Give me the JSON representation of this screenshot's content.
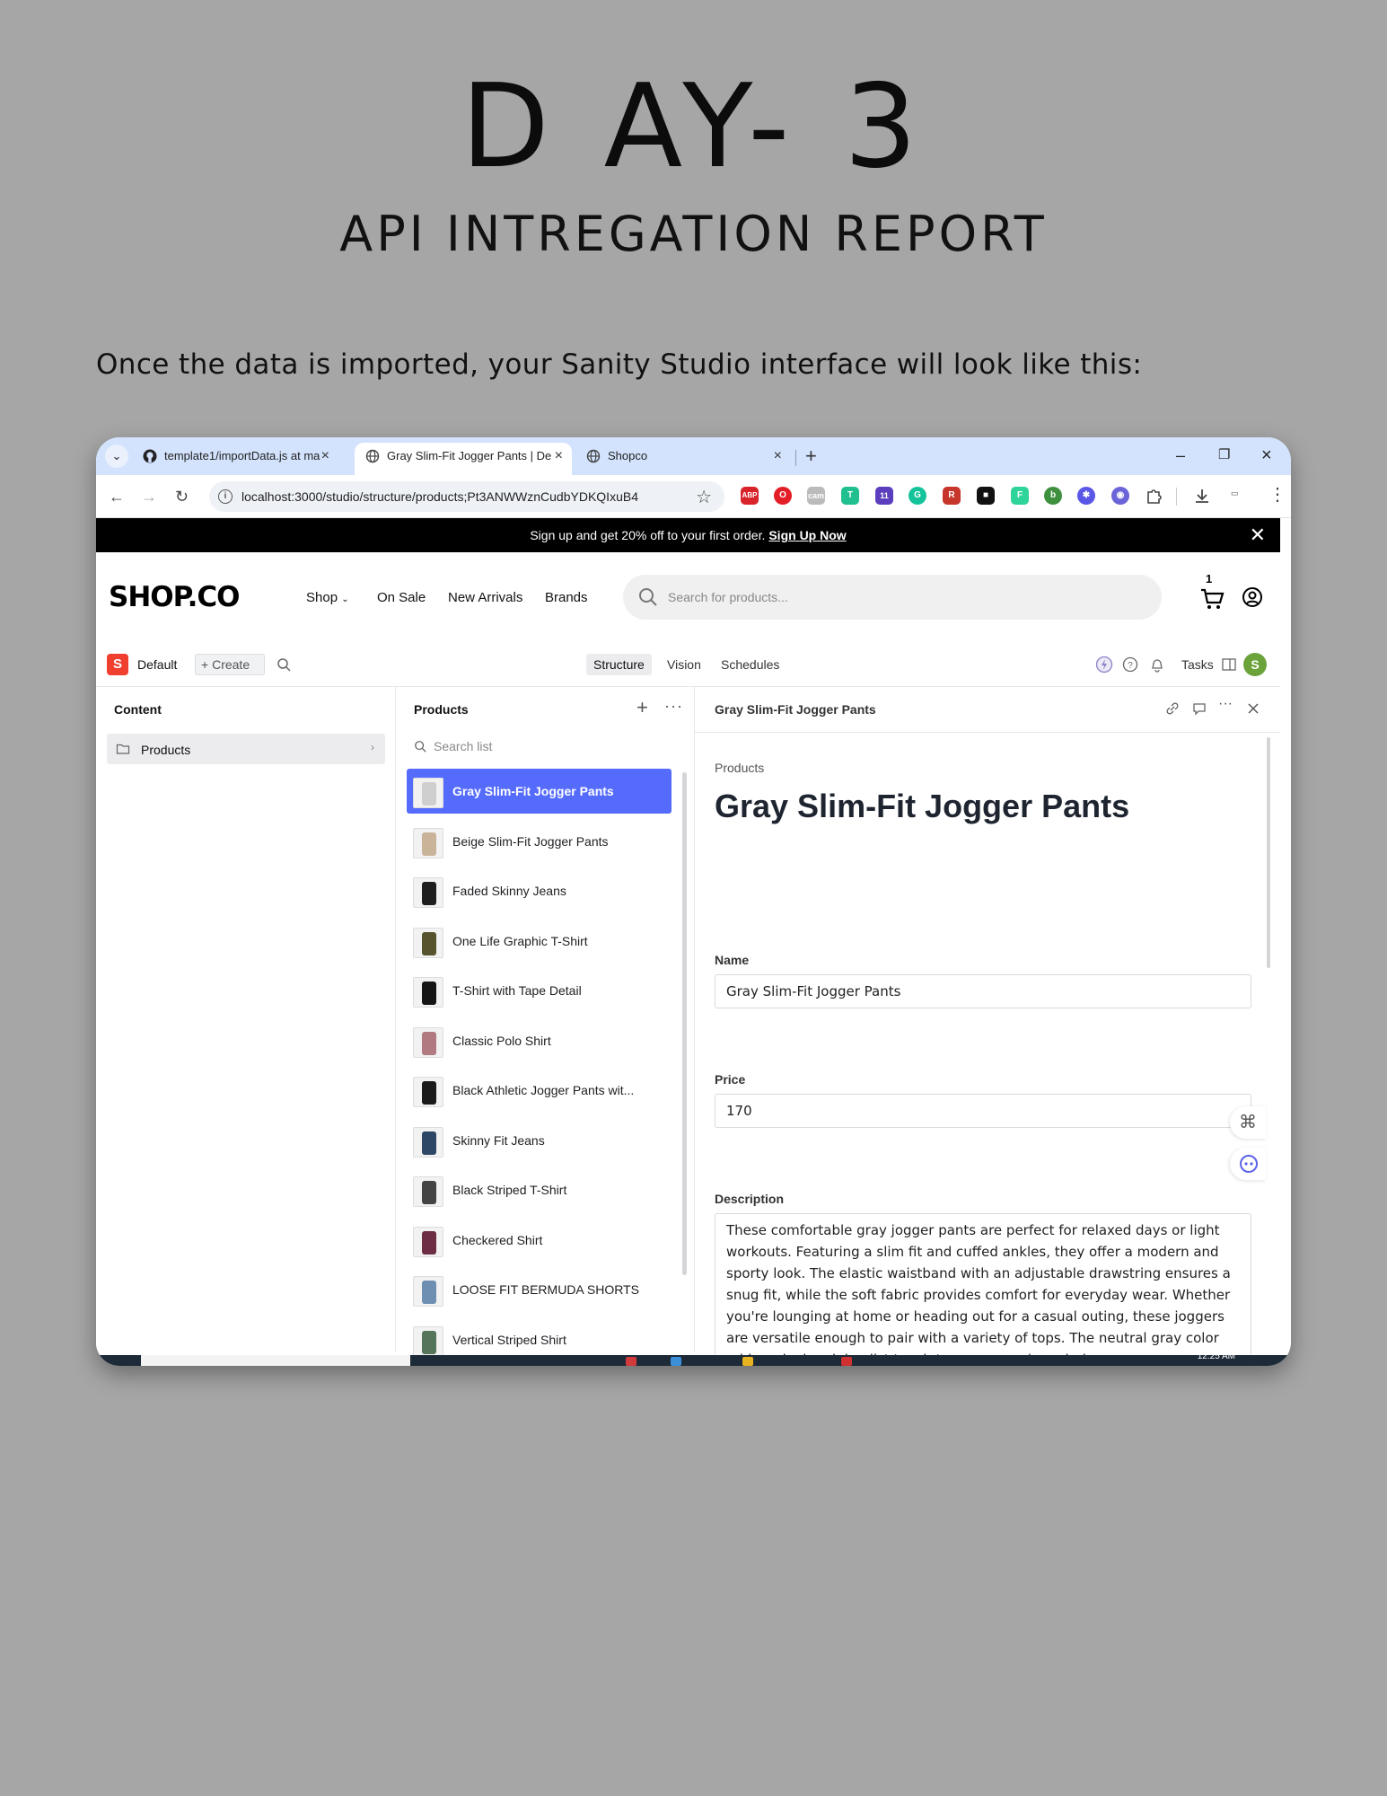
{
  "page": {
    "title": "D AY- 3",
    "subtitle": "API INTREGATION REPORT",
    "intro": "Once the data is imported, your Sanity Studio interface will look like this:"
  },
  "browser": {
    "tabs": [
      {
        "label": "template1/importData.js at ma",
        "icon": "github-icon"
      },
      {
        "label": "Gray Slim-Fit Jogger Pants | De",
        "icon": "globe-icon",
        "active": true
      },
      {
        "label": "Shopco",
        "icon": "globe-icon"
      }
    ],
    "url": "localhost:3000/studio/structure/products;Pt3ANWWznCudbYDKQIxuB4",
    "extensions": [
      "ABP",
      "O",
      "cam",
      "T",
      "11",
      "G",
      "R",
      "■",
      "F",
      "b",
      "✱",
      "◉"
    ]
  },
  "promo": {
    "text": "Sign up and get 20% off to your first order.",
    "link": "Sign Up Now"
  },
  "shop": {
    "logo": "SHOP.CO",
    "nav": [
      "Shop",
      "On Sale",
      "New Arrivals",
      "Brands"
    ],
    "search_placeholder": "Search for products...",
    "cart_count": "1"
  },
  "studio": {
    "workspace_badge": "S",
    "workspace": "Default",
    "create": "Create",
    "tools": [
      "Structure",
      "Vision",
      "Schedules"
    ],
    "tasks": "Tasks",
    "avatar": "S"
  },
  "content_pane": {
    "title": "Content",
    "items": [
      {
        "label": "Products"
      }
    ]
  },
  "list_pane": {
    "title": "Products",
    "search_placeholder": "Search list",
    "items": [
      {
        "name": "Gray Slim-Fit Jogger Pants",
        "selected": true,
        "color": "#cfcfcf"
      },
      {
        "name": "Beige Slim-Fit Jogger Pants",
        "color": "#c9b49a"
      },
      {
        "name": "Faded Skinny Jeans",
        "color": "#1e1e1e"
      },
      {
        "name": "One Life Graphic T-Shirt",
        "color": "#55542e"
      },
      {
        "name": "T-Shirt with Tape Detail",
        "color": "#151515"
      },
      {
        "name": "Classic Polo Shirt",
        "color": "#b07a80"
      },
      {
        "name": "Black Athletic Jogger Pants wit...",
        "color": "#1a1a1a"
      },
      {
        "name": "Skinny Fit Jeans",
        "color": "#2e4766"
      },
      {
        "name": "Black Striped T-Shirt",
        "color": "#444444"
      },
      {
        "name": "Checkered Shirt",
        "color": "#6d2e45"
      },
      {
        "name": "LOOSE FIT BERMUDA SHORTS",
        "color": "#6f8fb2"
      },
      {
        "name": "Vertical Striped Shirt",
        "color": "#54755a"
      }
    ]
  },
  "doc_pane": {
    "header_title": "Gray Slim-Fit Jogger Pants",
    "breadcrumb": "Products",
    "heading": "Gray Slim-Fit Jogger Pants",
    "fields": {
      "name_label": "Name",
      "name_value": "Gray Slim-Fit Jogger Pants",
      "price_label": "Price",
      "price_value": "170",
      "description_label": "Description",
      "description_value": "These comfortable gray jogger pants are perfect for relaxed days or light workouts. Featuring a slim fit and cuffed ankles, they offer a modern and sporty look. The elastic waistband with an adjustable drawstring ensures a snug fit, while the soft fabric provides comfort for everyday wear. Whether you're lounging at home or heading out for a casual outing, these joggers are versatile enough to pair with a variety of tops. The neutral gray color adds a sleek, minimalist touch to your casual wardrobe."
    }
  },
  "taskbar": {
    "clock": "12:25 AM"
  },
  "colors": {
    "background": "#a6a6a6",
    "accent": "#556bfc",
    "brand": "#f03e2f"
  }
}
